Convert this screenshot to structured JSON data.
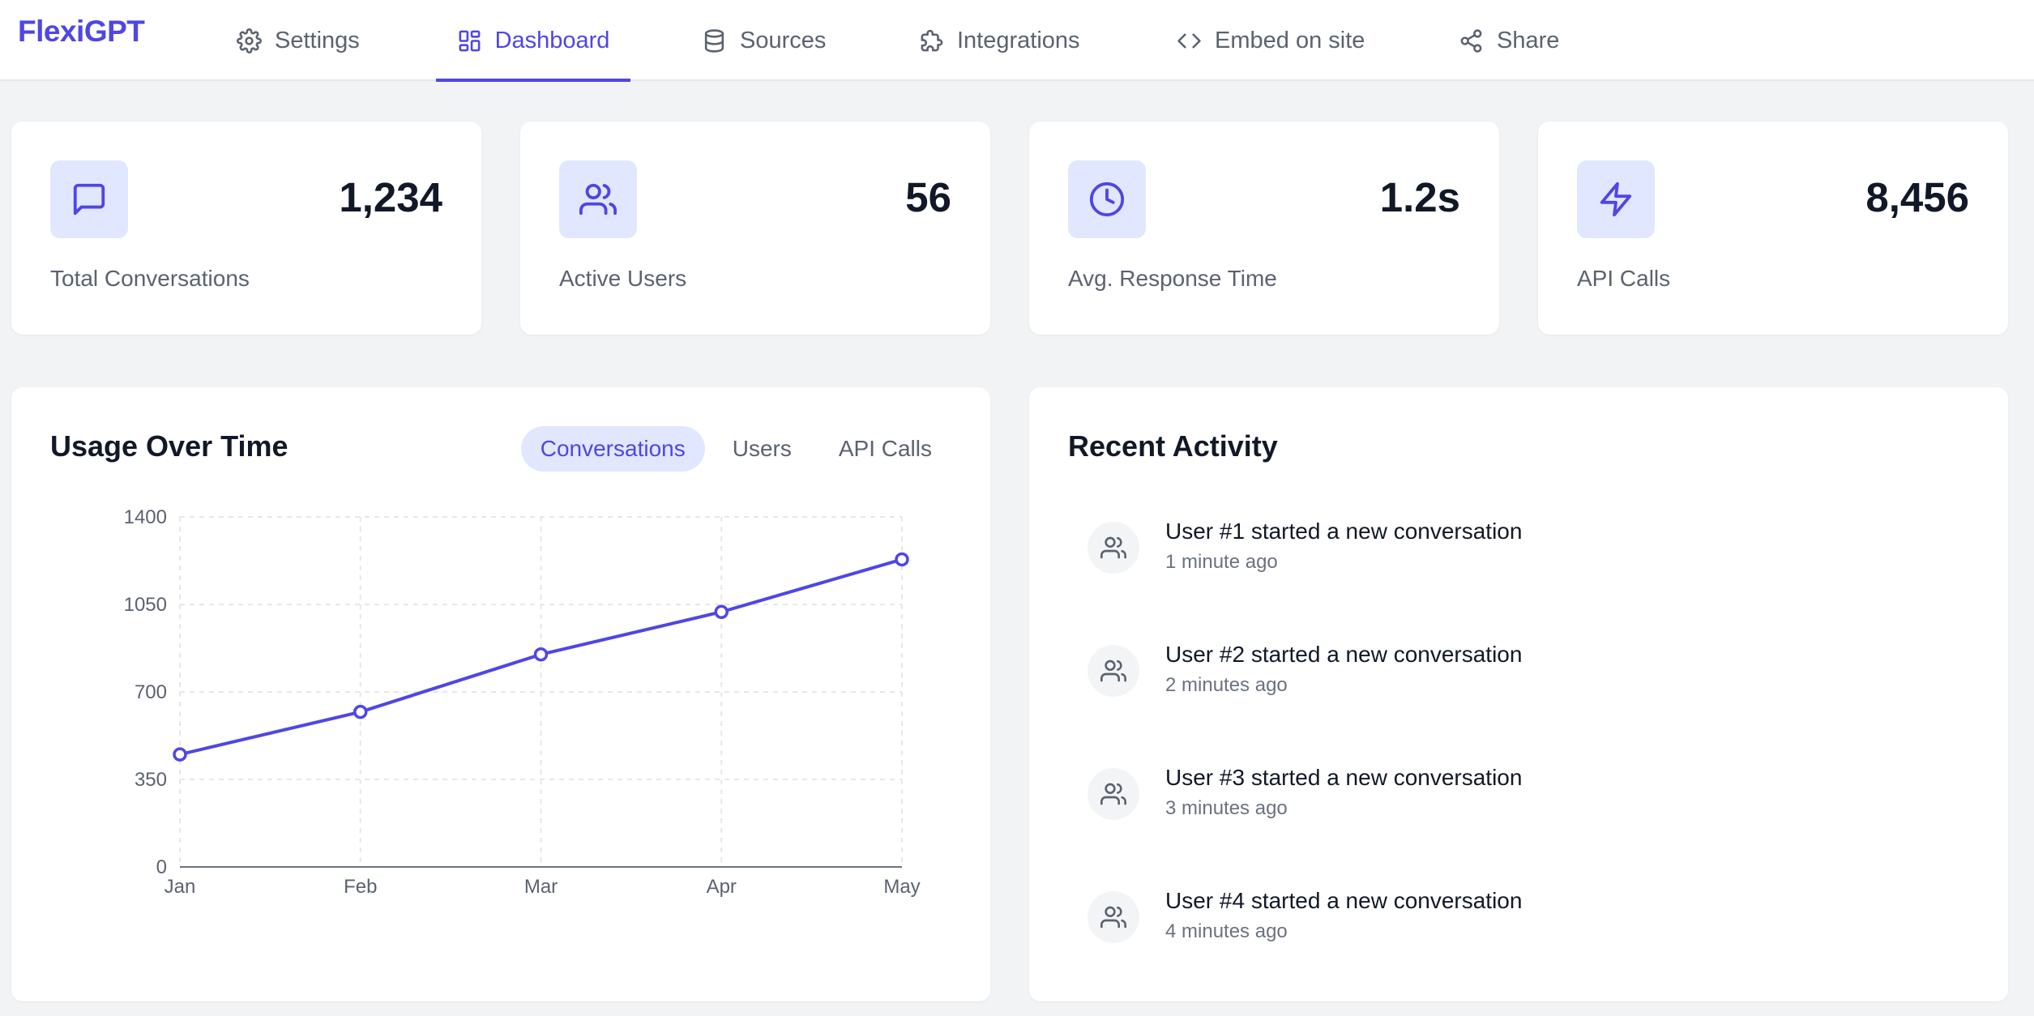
{
  "brand": "FlexiGPT",
  "nav": [
    {
      "label": "Settings",
      "icon": "gear-icon"
    },
    {
      "label": "Dashboard",
      "icon": "dashboard-grid-icon",
      "active": true
    },
    {
      "label": "Sources",
      "icon": "database-icon"
    },
    {
      "label": "Integrations",
      "icon": "puzzle-icon"
    },
    {
      "label": "Embed on site",
      "icon": "code-icon"
    },
    {
      "label": "Share",
      "icon": "share-icon"
    }
  ],
  "stats": [
    {
      "value": "1,234",
      "label": "Total Conversations",
      "icon": "message-square-icon"
    },
    {
      "value": "56",
      "label": "Active Users",
      "icon": "users-icon"
    },
    {
      "value": "1.2s",
      "label": "Avg. Response Time",
      "icon": "clock-icon"
    },
    {
      "value": "8,456",
      "label": "API Calls",
      "icon": "zap-icon"
    }
  ],
  "usage": {
    "title": "Usage Over Time",
    "tabs": [
      {
        "label": "Conversations",
        "active": true
      },
      {
        "label": "Users"
      },
      {
        "label": "API Calls"
      }
    ]
  },
  "chart_data": {
    "type": "line",
    "x": [
      "Jan",
      "Feb",
      "Mar",
      "Apr",
      "May"
    ],
    "series": [
      {
        "values": [
          450,
          620,
          850,
          1020,
          1230
        ]
      }
    ],
    "ylim": [
      0,
      1400
    ],
    "yticks": [
      0,
      350,
      700,
      1050,
      1400
    ],
    "grid": true,
    "color": "#4f46e5"
  },
  "activity": {
    "title": "Recent Activity",
    "items": [
      {
        "text": "User #1 started a new conversation",
        "time": "1 minute ago"
      },
      {
        "text": "User #2 started a new conversation",
        "time": "2 minutes ago"
      },
      {
        "text": "User #3 started a new conversation",
        "time": "3 minutes ago"
      },
      {
        "text": "User #4 started a new conversation",
        "time": "4 minutes ago"
      }
    ]
  },
  "colors": {
    "accent": "#4f46e5",
    "accent_soft": "#e0e7ff",
    "bg": "#f2f3f5"
  }
}
